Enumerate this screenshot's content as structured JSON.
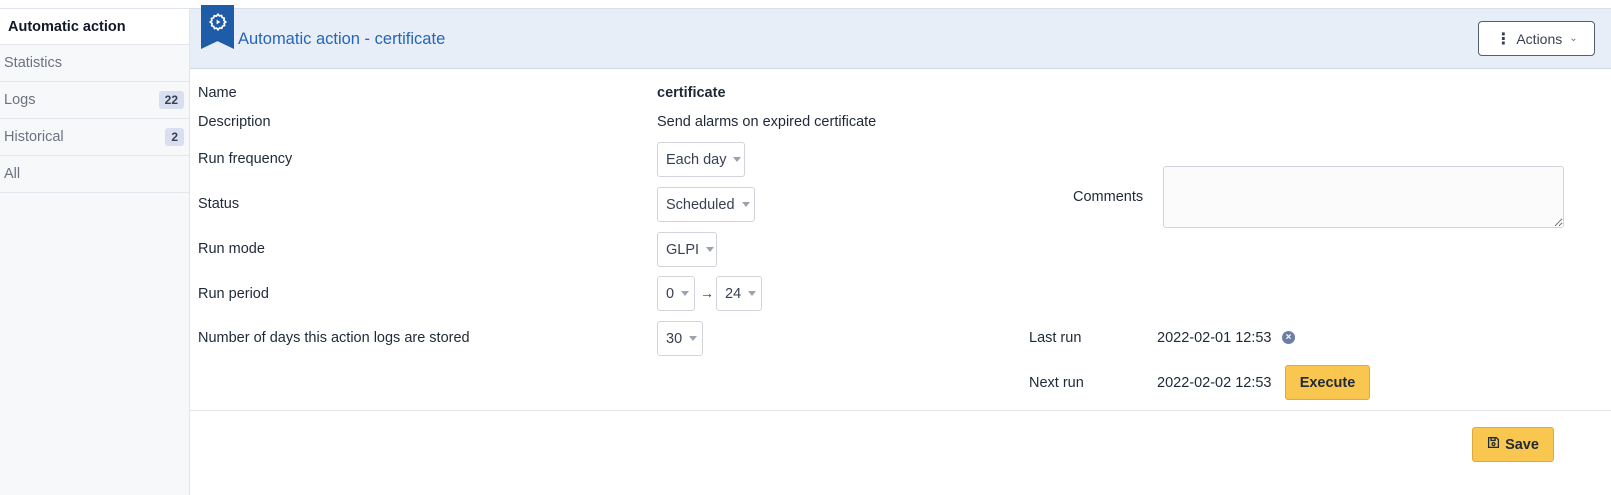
{
  "sidebar": {
    "items": [
      {
        "label": "Automatic action"
      },
      {
        "label": "Statistics"
      },
      {
        "label": "Logs",
        "count": "22"
      },
      {
        "label": "Historical",
        "count": "2"
      },
      {
        "label": "All"
      }
    ]
  },
  "header": {
    "icon": "gear-play-icon",
    "title": "Automatic action - certificate",
    "actions_label": "Actions"
  },
  "form": {
    "name_label": "Name",
    "name_value": "certificate",
    "description_label": "Description",
    "description_value": "Send alarms on expired certificate",
    "frequency_label": "Run frequency",
    "frequency_value": "Each day",
    "status_label": "Status",
    "status_value": "Scheduled",
    "mode_label": "Run mode",
    "mode_value": "GLPI",
    "period_label": "Run period",
    "period_from": "0",
    "period_to": "24",
    "logs_label": "Number of days this action logs are stored",
    "logs_value": "30",
    "comments_label": "Comments",
    "comments_value": "",
    "last_run_label": "Last run",
    "last_run_value": "2022-02-01 12:53",
    "next_run_label": "Next run",
    "next_run_value": "2022-02-02 12:53",
    "execute_label": "Execute",
    "save_label": "Save"
  },
  "colors": {
    "accent": "#2566b8",
    "ribbon": "#1f5ca8",
    "button_warning": "#f9c74f",
    "header_bg": "#e8eef8"
  }
}
